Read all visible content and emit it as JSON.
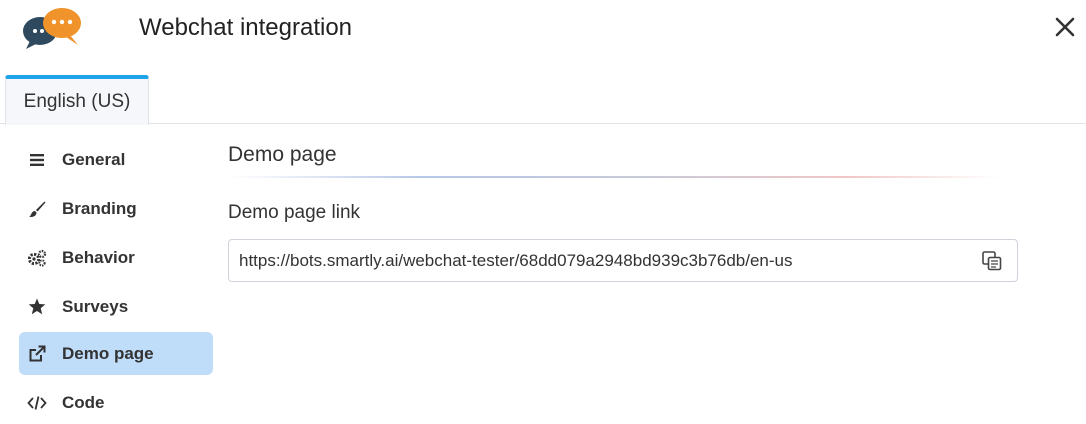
{
  "header": {
    "title": "Webchat integration",
    "logo_icon": "chat-bubbles-icon",
    "close_icon": "close-icon"
  },
  "tabs": [
    {
      "label": "English (US)",
      "active": true
    }
  ],
  "sidebar": {
    "items": [
      {
        "label": "General",
        "icon": "list-icon",
        "active": false
      },
      {
        "label": "Branding",
        "icon": "paintbrush-icon",
        "active": false
      },
      {
        "label": "Behavior",
        "icon": "gears-icon",
        "active": false
      },
      {
        "label": "Surveys",
        "icon": "star-icon",
        "active": false
      },
      {
        "label": "Demo page",
        "icon": "external-link-icon",
        "active": true
      },
      {
        "label": "Code",
        "icon": "code-icon",
        "active": false
      }
    ]
  },
  "main": {
    "section_title": "Demo page",
    "field_label": "Demo page link",
    "link_value": "https://bots.smartly.ai/webchat-tester/68dd079a2948bd939c3b76db/en-us",
    "copy_icon": "copy-icon"
  },
  "colors": {
    "accent": "#1ea3e8",
    "active_nav_bg": "#bfdcf8",
    "logo_dark": "#2f4a5e",
    "logo_orange": "#f0932b"
  }
}
